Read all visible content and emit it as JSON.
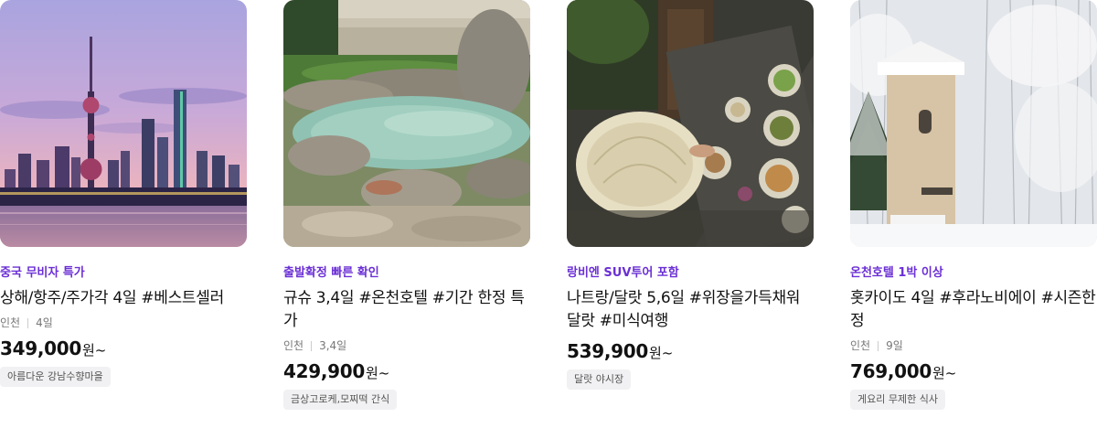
{
  "cards": [
    {
      "image_alt": "Shanghai skyline at dusk",
      "tag": "중국 무비자 특가",
      "title": "상해/항주/주가각 4일 #베스트셀러",
      "departure": "인천",
      "duration": "4일",
      "price": "349,000",
      "price_unit": "원~",
      "chip": "아름다운 강남수향마을"
    },
    {
      "image_alt": "Outdoor hot spring rock pool",
      "tag": "출발확정 빠른 확인",
      "title": "규슈 3,4일 #온천호텔 #기간 한정 특가",
      "departure": "인천",
      "duration": "3,4일",
      "price": "429,900",
      "price_unit": "원~",
      "chip": "금상고로케,모찌떡 간식"
    },
    {
      "image_alt": "Vietnamese conical hat and food on table",
      "tag": "랑비엔 SUV투어 포함",
      "title": "나트랑/달랏 5,6일 #위장을가득채워달랏 #미식여행",
      "departure": "",
      "duration": "",
      "price": "539,900",
      "price_unit": "원~",
      "chip": "달랏 야시장"
    },
    {
      "image_alt": "Snowy forest with tower building",
      "tag": "온천호텔 1박 이상",
      "title": "홋카이도 4일 #후라노비에이 #시즌한정",
      "departure": "인천",
      "duration": "9일",
      "price": "769,000",
      "price_unit": "원~",
      "chip": "게요리 무제한 식사"
    }
  ]
}
